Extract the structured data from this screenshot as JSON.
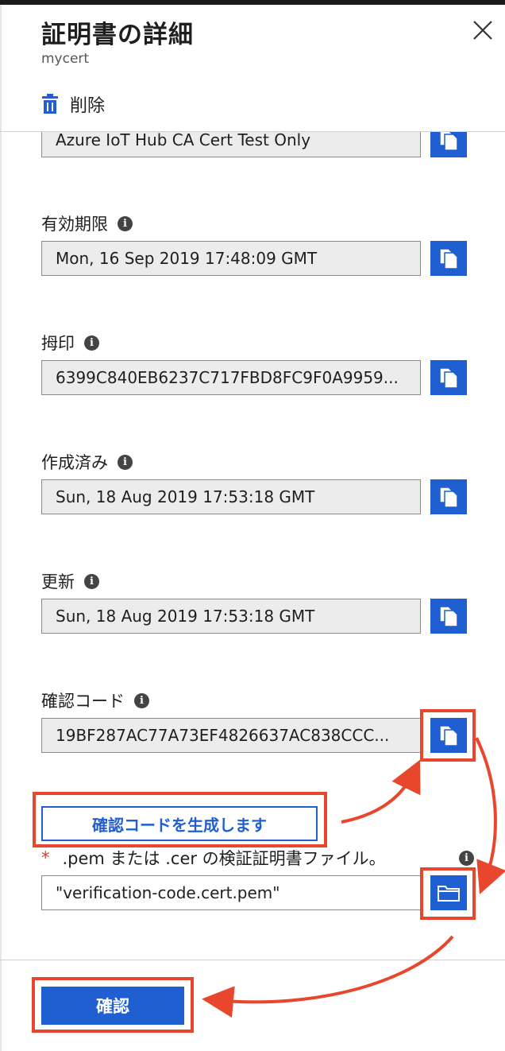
{
  "header": {
    "title": "証明書の詳細",
    "subtitle": "mycert",
    "delete_label": "削除"
  },
  "fields": {
    "subject": {
      "value": "Azure IoT Hub CA Cert Test Only"
    },
    "expiry": {
      "label": "有効期限",
      "value": "Mon, 16 Sep 2019 17:48:09 GMT"
    },
    "thumbprint": {
      "label": "拇印",
      "value": "6399C840EB6237C717FBD8FC9F0A9959..."
    },
    "created": {
      "label": "作成済み",
      "value": "Sun, 18 Aug 2019 17:53:18 GMT"
    },
    "updated": {
      "label": "更新",
      "value": "Sun, 18 Aug 2019 17:53:18 GMT"
    },
    "verification_code": {
      "label": "確認コード",
      "value": "19BF287AC77A73EF4826637AC838CCC..."
    }
  },
  "generate_button_label": "確認コードを生成します",
  "upload": {
    "required_marker": "*",
    "label": ".pem または .cer の検証証明書ファイル。",
    "value": "\"verification-code.cert.pem\""
  },
  "footer": {
    "confirm_label": "確認"
  },
  "colors": {
    "accent": "#1f5fd1",
    "annotation": "#e8462d"
  }
}
